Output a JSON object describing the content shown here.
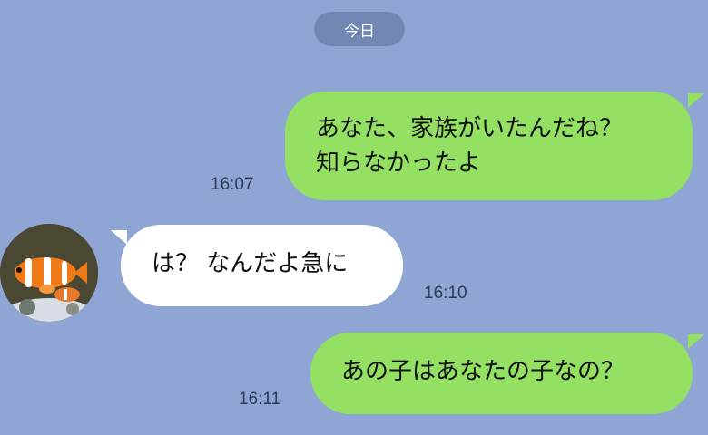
{
  "date_divider": "今日",
  "messages": [
    {
      "direction": "outgoing",
      "lines": [
        "あなた、家族がいたんだね？",
        "知らなかったよ"
      ],
      "time": "16:07"
    },
    {
      "direction": "incoming",
      "lines": [
        "は？ なんだよ急に"
      ],
      "time": "16:10"
    },
    {
      "direction": "outgoing",
      "lines": [
        "あの子はあなたの子なの？"
      ],
      "time": "16:11"
    }
  ],
  "colors": {
    "background": "#8fa6d4",
    "outgoing_bubble": "#93e062",
    "incoming_bubble": "#ffffff",
    "date_pill": "#7287b3"
  },
  "avatar_icon": "clownfish-avatar"
}
